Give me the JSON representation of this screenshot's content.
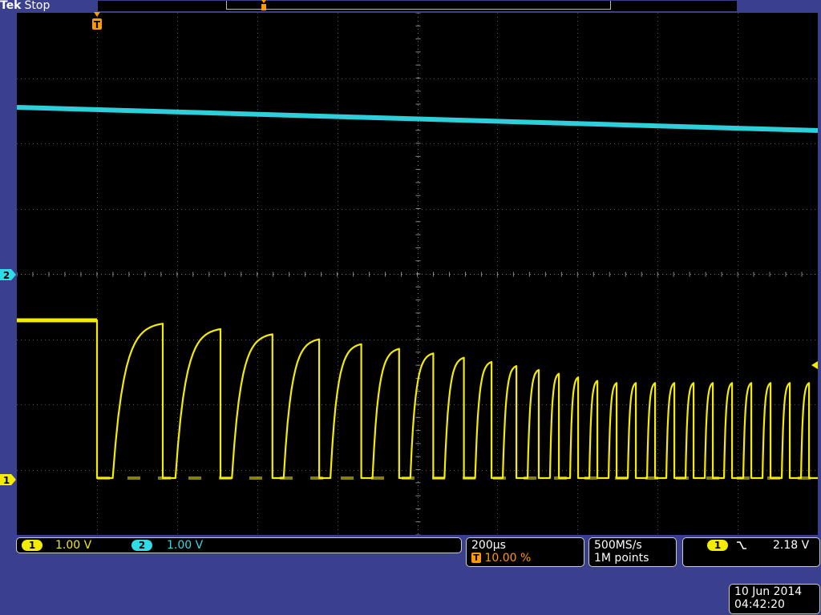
{
  "header": {
    "brand": "Tek",
    "status": "Stop",
    "trigger_marker_label": "T"
  },
  "markers": {
    "ch2": "2",
    "ch1": "1",
    "trigger_level": "◂"
  },
  "channels": [
    {
      "id": "1",
      "scale": "1.00 V",
      "color": "#f4ec00"
    },
    {
      "id": "2",
      "scale": "1.00 V",
      "color": "#2fdbe6"
    }
  ],
  "timebase": {
    "scale": "200µs",
    "trigger_badge": "T",
    "trigger_position": "10.00 %"
  },
  "acquisition": {
    "sample_rate": "500MS/s",
    "record_length": "1M points"
  },
  "trigger": {
    "source": "1",
    "slope_icon": "falling-edge-icon",
    "level": "2.18 V"
  },
  "datetime": {
    "date": "10 Jun 2014",
    "time": "04:42:20"
  },
  "colors": {
    "background": "#3a3f8e",
    "screen": "#000000",
    "ch1": "#f4ec00",
    "ch2": "#2fdbe6",
    "trigger": "#ff9a00",
    "grid": "#8a8a8a"
  }
}
